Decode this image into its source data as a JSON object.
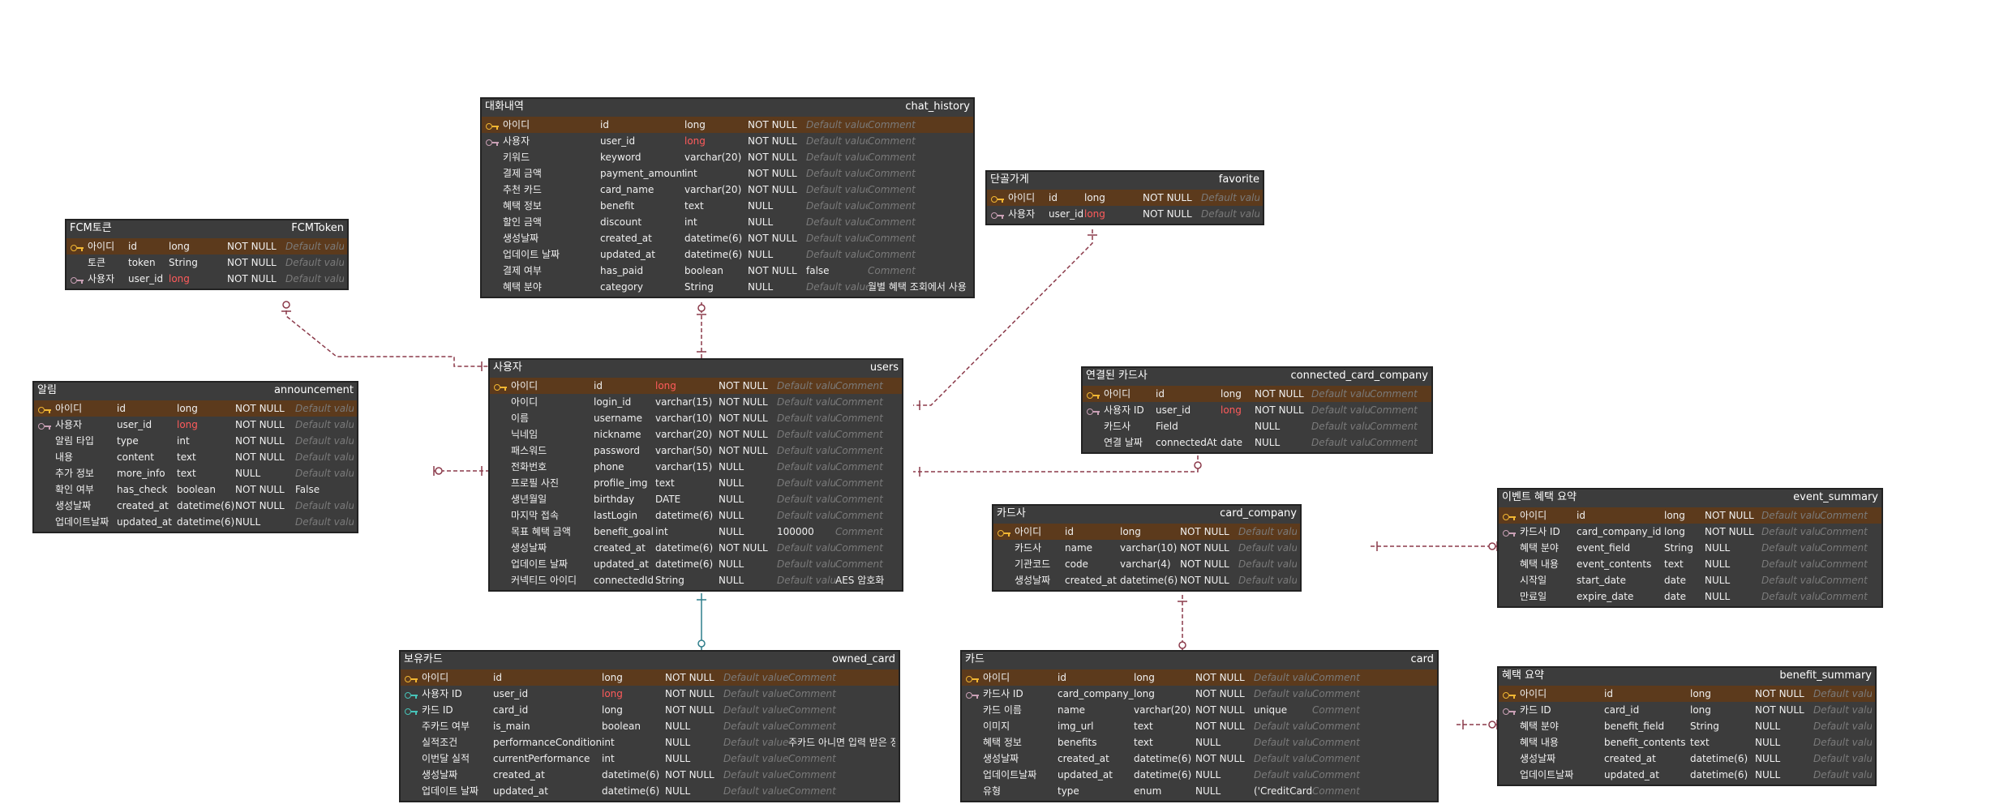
{
  "colors": {
    "pk_row": "#5c3a1c",
    "table_bg": "#3c3c3c",
    "primary_key_icon": "#f2b632",
    "foreign_key_icon": "#c9a0b5",
    "owned_card_key_icon": "#47c3b8",
    "relation_line": "#8b3a4a",
    "owned_card_line": "#2e7d8a",
    "highlight_type": "#ff5b5b"
  },
  "tables": [
    {
      "id": "chat_history",
      "label": "대화내역",
      "name": "chat_history",
      "rows": [
        {
          "key": "pk",
          "label": "아이디",
          "column": "id",
          "type": "long",
          "nullable": "NOT NULL",
          "default": "Default value",
          "comment": "Comment"
        },
        {
          "key": "fk",
          "label": "사용자",
          "column": "user_id",
          "type": "long",
          "type_highlight": true,
          "nullable": "NOT NULL",
          "default": "Default value",
          "comment": "Comment"
        },
        {
          "key": "",
          "label": "키워드",
          "column": "keyword",
          "type": "varchar(20)",
          "nullable": "NOT NULL",
          "default": "Default value",
          "comment": "Comment"
        },
        {
          "key": "",
          "label": "결제 금액",
          "column": "payment_amount",
          "type": "int",
          "nullable": "NOT NULL",
          "default": "Default value",
          "comment": "Comment"
        },
        {
          "key": "",
          "label": "추천 카드",
          "column": "card_name",
          "type": "varchar(20)",
          "nullable": "NOT NULL",
          "default": "Default value",
          "comment": "Comment"
        },
        {
          "key": "",
          "label": "혜택 정보",
          "column": "benefit",
          "type": "text",
          "nullable": "NULL",
          "default": "Default value",
          "comment": "Comment"
        },
        {
          "key": "",
          "label": "할인 금액",
          "column": "discount",
          "type": "int",
          "nullable": "NULL",
          "default": "Default value",
          "comment": "Comment"
        },
        {
          "key": "",
          "label": "생성날짜",
          "column": "created_at",
          "type": "datetime(6)",
          "nullable": "NOT NULL",
          "default": "Default value",
          "comment": "Comment"
        },
        {
          "key": "",
          "label": "업데이트 날짜",
          "column": "updated_at",
          "type": "datetime(6)",
          "nullable": "NULL",
          "default": "Default value",
          "comment": "Comment"
        },
        {
          "key": "",
          "label": "결제 여부",
          "column": "has_paid",
          "type": "boolean",
          "nullable": "NOT NULL",
          "default": "false",
          "default_set": true,
          "comment": "Comment"
        },
        {
          "key": "",
          "label": "혜택 분야",
          "column": "category",
          "type": "String",
          "nullable": "NULL",
          "default": "Default value",
          "comment": "월별 혜택 조회에서 사용",
          "comment_set": true
        }
      ]
    },
    {
      "id": "favorite",
      "label": "단골가게",
      "name": "favorite",
      "rows": [
        {
          "key": "pk",
          "label": "아이디",
          "column": "id",
          "type": "long",
          "nullable": "NOT NULL",
          "default": "Default value",
          "comment": "Comment"
        },
        {
          "key": "fk",
          "label": "사용자",
          "column": "user_id",
          "type": "long",
          "type_highlight": true,
          "nullable": "NOT NULL",
          "default": "Default value",
          "comment": "Comment"
        }
      ]
    },
    {
      "id": "fcmtoken",
      "label": "FCM토큰",
      "name": "FCMToken",
      "rows": [
        {
          "key": "pk",
          "label": "아이디",
          "column": "id",
          "type": "long",
          "nullable": "NOT NULL",
          "default": "Default value",
          "comment": "Comment"
        },
        {
          "key": "",
          "label": "토큰",
          "column": "token",
          "type": "String",
          "nullable": "NOT NULL",
          "default": "Default value",
          "comment": "Comment"
        },
        {
          "key": "fk",
          "label": "사용자",
          "column": "user_id",
          "type": "long",
          "type_highlight": true,
          "nullable": "NOT NULL",
          "default": "Default value",
          "comment": "Comment"
        }
      ]
    },
    {
      "id": "announcement",
      "label": "알림",
      "name": "announcement",
      "rows": [
        {
          "key": "pk",
          "label": "아이디",
          "column": "id",
          "type": "long",
          "nullable": "NOT NULL",
          "default": "Default value",
          "comment": "Comment"
        },
        {
          "key": "fk",
          "label": "사용자",
          "column": "user_id",
          "type": "long",
          "type_highlight": true,
          "nullable": "NOT NULL",
          "default": "Default value",
          "comment": "Comment"
        },
        {
          "key": "",
          "label": "알림 타입",
          "column": "type",
          "type": "int",
          "nullable": "NOT NULL",
          "default": "Default value",
          "comment": "Comment"
        },
        {
          "key": "",
          "label": "내용",
          "column": "content",
          "type": "text",
          "nullable": "NOT NULL",
          "default": "Default value",
          "comment": "Comment"
        },
        {
          "key": "",
          "label": "추가 정보",
          "column": "more_info",
          "type": "text",
          "nullable": "NULL",
          "default": "Default value",
          "comment": "Comment"
        },
        {
          "key": "",
          "label": "확인 여부",
          "column": "has_check",
          "type": "boolean",
          "nullable": "NOT NULL",
          "default": "False",
          "default_set": true,
          "comment": "Comment"
        },
        {
          "key": "",
          "label": "생성날짜",
          "column": "created_at",
          "type": "datetime(6)",
          "nullable": "NOT NULL",
          "default": "Default value",
          "comment": "Comment"
        },
        {
          "key": "",
          "label": "업데이트날짜",
          "column": "updated_at",
          "type": "datetime(6)",
          "nullable": "NULL",
          "default": "Default value",
          "comment": "Comment"
        }
      ]
    },
    {
      "id": "users",
      "label": "사용자",
      "name": "users",
      "rows": [
        {
          "key": "pk",
          "label": "아이디",
          "column": "id",
          "type": "long",
          "type_highlight": true,
          "nullable": "NOT NULL",
          "default": "Default value",
          "comment": "Comment"
        },
        {
          "key": "",
          "label": "아이디",
          "column": "login_id",
          "type": "varchar(15)",
          "nullable": "NOT NULL",
          "default": "Default value",
          "comment": "Comment"
        },
        {
          "key": "",
          "label": "이름",
          "column": "username",
          "type": "varchar(10)",
          "nullable": "NOT NULL",
          "default": "Default value",
          "comment": "Comment"
        },
        {
          "key": "",
          "label": "닉네임",
          "column": "nickname",
          "type": "varchar(20)",
          "nullable": "NOT NULL",
          "default": "Default value",
          "comment": "Comment"
        },
        {
          "key": "",
          "label": "패스워드",
          "column": "password",
          "type": "varchar(50)",
          "nullable": "NOT NULL",
          "default": "Default value",
          "comment": "Comment"
        },
        {
          "key": "",
          "label": "전화번호",
          "column": "phone",
          "type": "varchar(15)",
          "nullable": "NULL",
          "default": "Default value",
          "comment": "Comment"
        },
        {
          "key": "",
          "label": "프로필 사진",
          "column": "profile_img",
          "type": "text",
          "nullable": "NULL",
          "default": "Default value",
          "comment": "Comment"
        },
        {
          "key": "",
          "label": "생년월일",
          "column": "birthday",
          "type": "DATE",
          "nullable": "NULL",
          "default": "Default value",
          "comment": "Comment"
        },
        {
          "key": "",
          "label": "마지막 접속",
          "column": "lastLogin",
          "type": "datetime(6)",
          "nullable": "NULL",
          "default": "Default value",
          "comment": "Comment"
        },
        {
          "key": "",
          "label": "목표 혜택 금액",
          "column": "benefit_goal",
          "type": "int",
          "nullable": "NULL",
          "default": "100000",
          "default_set": true,
          "comment": "Comment"
        },
        {
          "key": "",
          "label": "생성날짜",
          "column": "created_at",
          "type": "datetime(6)",
          "nullable": "NOT NULL",
          "default": "Default value",
          "comment": "Comment"
        },
        {
          "key": "",
          "label": "업데이트 날짜",
          "column": "updated_at",
          "type": "datetime(6)",
          "nullable": "NULL",
          "default": "Default value",
          "comment": "Comment"
        },
        {
          "key": "",
          "label": "커넥티드 아이디",
          "column": "connectedId",
          "type": "String",
          "nullable": "NULL",
          "default": "Default value",
          "comment": "AES 암호화",
          "comment_set": true
        }
      ]
    },
    {
      "id": "connected_card_company",
      "label": "연결된 카드사",
      "name": "connected_card_company",
      "rows": [
        {
          "key": "pk",
          "label": "아이디",
          "column": "id",
          "type": "long",
          "nullable": "NOT NULL",
          "default": "Default value",
          "comment": "Comment"
        },
        {
          "key": "fk",
          "label": "사용자 ID",
          "column": "user_id",
          "type": "long",
          "type_highlight": true,
          "nullable": "NOT NULL",
          "default": "Default value",
          "comment": "Comment"
        },
        {
          "key": "",
          "label": "카드사",
          "column": "Field",
          "type": "",
          "nullable": "NULL",
          "default": "Default value",
          "comment": "Comment"
        },
        {
          "key": "",
          "label": "연결 날짜",
          "column": "connectedAt",
          "type": "date",
          "nullable": "NULL",
          "default": "Default value",
          "comment": "Comment"
        }
      ]
    },
    {
      "id": "card_company",
      "label": "카드사",
      "name": "card_company",
      "rows": [
        {
          "key": "pk",
          "label": "아이디",
          "column": "id",
          "type": "long",
          "nullable": "NOT NULL",
          "default": "Default value",
          "comment": "Comment"
        },
        {
          "key": "",
          "label": "카드사",
          "column": "name",
          "type": "varchar(10)",
          "nullable": "NOT NULL",
          "default": "Default value",
          "comment": "Comment"
        },
        {
          "key": "",
          "label": "기관코드",
          "column": "code",
          "type": "varchar(4)",
          "nullable": "NOT NULL",
          "default": "Default value",
          "comment": "Comment"
        },
        {
          "key": "",
          "label": "생성날짜",
          "column": "created_at",
          "type": "datetime(6)",
          "nullable": "NOT NULL",
          "default": "Default value",
          "comment": "Comment"
        }
      ]
    },
    {
      "id": "event_summary",
      "label": "이벤트 혜택 요약",
      "name": "event_summary",
      "rows": [
        {
          "key": "pk",
          "label": "아이디",
          "column": "id",
          "type": "long",
          "nullable": "NOT NULL",
          "default": "Default value",
          "comment": "Comment"
        },
        {
          "key": "fk",
          "label": "카드사 ID",
          "column": "card_company_id",
          "type": "long",
          "nullable": "NOT NULL",
          "default": "Default value",
          "comment": "Comment"
        },
        {
          "key": "",
          "label": "혜택 분야",
          "column": "event_field",
          "type": "String",
          "nullable": "NULL",
          "default": "Default value",
          "comment": "Comment"
        },
        {
          "key": "",
          "label": "혜택 내용",
          "column": "event_contents",
          "type": "text",
          "nullable": "NULL",
          "default": "Default value",
          "comment": "Comment"
        },
        {
          "key": "",
          "label": "시작일",
          "column": "start_date",
          "type": "date",
          "nullable": "NULL",
          "default": "Default value",
          "comment": "Comment"
        },
        {
          "key": "",
          "label": "만료일",
          "column": "expire_date",
          "type": "date",
          "nullable": "NULL",
          "default": "Default value",
          "comment": "Comment"
        }
      ]
    },
    {
      "id": "owned_card",
      "label": "보유카드",
      "name": "owned_card",
      "rows": [
        {
          "key": "pk",
          "label": "아이디",
          "column": "id",
          "type": "long",
          "nullable": "NOT NULL",
          "default": "Default value",
          "comment": "Comment"
        },
        {
          "key": "teal",
          "label": "사용자 ID",
          "column": "user_id",
          "type": "long",
          "type_highlight": true,
          "nullable": "NOT NULL",
          "default": "Default value",
          "comment": "Comment"
        },
        {
          "key": "teal",
          "label": "카드 ID",
          "column": "card_id",
          "type": "long",
          "nullable": "NOT NULL",
          "default": "Default value",
          "comment": "Comment"
        },
        {
          "key": "",
          "label": "주카드 여부",
          "column": "is_main",
          "type": "boolean",
          "nullable": "NULL",
          "default": "Default value",
          "comment": "Comment"
        },
        {
          "key": "",
          "label": "실적조건",
          "column": "performanceCondition",
          "type": "int",
          "nullable": "NULL",
          "default": "Default value",
          "comment": "주카드 아니면 입력 받은 정보",
          "comment_set": true
        },
        {
          "key": "",
          "label": "이번달 실적",
          "column": "currentPerformance",
          "type": "int",
          "nullable": "NULL",
          "default": "Default value",
          "comment": "Comment"
        },
        {
          "key": "",
          "label": "생성날짜",
          "column": "created_at",
          "type": "datetime(6)",
          "nullable": "NOT NULL",
          "default": "Default value",
          "comment": "Comment"
        },
        {
          "key": "",
          "label": "업데이트 날짜",
          "column": "updated_at",
          "type": "datetime(6)",
          "nullable": "NULL",
          "default": "Default value",
          "comment": "Comment"
        }
      ]
    },
    {
      "id": "card",
      "label": "카드",
      "name": "card",
      "rows": [
        {
          "key": "pk",
          "label": "아이디",
          "column": "id",
          "type": "long",
          "nullable": "NOT NULL",
          "default": "Default value",
          "comment": "Comment"
        },
        {
          "key": "fk",
          "label": "카드사 ID",
          "column": "card_company_id",
          "type": "long",
          "nullable": "NOT NULL",
          "default": "Default value",
          "comment": "Comment"
        },
        {
          "key": "",
          "label": "카드 이름",
          "column": "name",
          "type": "varchar(20)",
          "nullable": "NOT NULL",
          "default": "unique",
          "default_set": true,
          "comment": "Comment"
        },
        {
          "key": "",
          "label": "이미지",
          "column": "img_url",
          "type": "text",
          "nullable": "NOT NULL",
          "default": "Default value",
          "comment": "Comment"
        },
        {
          "key": "",
          "label": "혜택 정보",
          "column": "benefits",
          "type": "text",
          "nullable": "NULL",
          "default": "Default value",
          "comment": "Comment"
        },
        {
          "key": "",
          "label": "생성날짜",
          "column": "created_at",
          "type": "datetime(6)",
          "nullable": "NOT NULL",
          "default": "Default value",
          "comment": "Comment"
        },
        {
          "key": "",
          "label": "업데이트날짜",
          "column": "updated_at",
          "type": "datetime(6)",
          "nullable": "NULL",
          "default": "Default value",
          "comment": "Comment"
        },
        {
          "key": "",
          "label": "유형",
          "column": "type",
          "type": "enum",
          "nullable": "NULL",
          "default": "('CreditCard', 'DebitCard')",
          "default_set": true,
          "comment": "Comment"
        }
      ]
    },
    {
      "id": "benefit_summary",
      "label": "혜택 요약",
      "name": "benefit_summary",
      "rows": [
        {
          "key": "pk",
          "label": "아이디",
          "column": "id",
          "type": "long",
          "nullable": "NOT NULL",
          "default": "Default value",
          "comment": "Comment"
        },
        {
          "key": "fk",
          "label": "카드 ID",
          "column": "card_id",
          "type": "long",
          "nullable": "NOT NULL",
          "default": "Default value",
          "comment": "Comment"
        },
        {
          "key": "",
          "label": "혜택 분야",
          "column": "benefit_field",
          "type": "String",
          "nullable": "NULL",
          "default": "Default value",
          "comment": "Comment"
        },
        {
          "key": "",
          "label": "혜택 내용",
          "column": "benefit_contents",
          "type": "text",
          "nullable": "NULL",
          "default": "Default value",
          "comment": "Comment"
        },
        {
          "key": "",
          "label": "생성날짜",
          "column": "created_at",
          "type": "datetime(6)",
          "nullable": "NULL",
          "default": "Default value",
          "comment": "Comment"
        },
        {
          "key": "",
          "label": "업데이트날짜",
          "column": "updated_at",
          "type": "datetime(6)",
          "nullable": "NULL",
          "default": "Default value",
          "comment": "Comment"
        }
      ]
    }
  ]
}
